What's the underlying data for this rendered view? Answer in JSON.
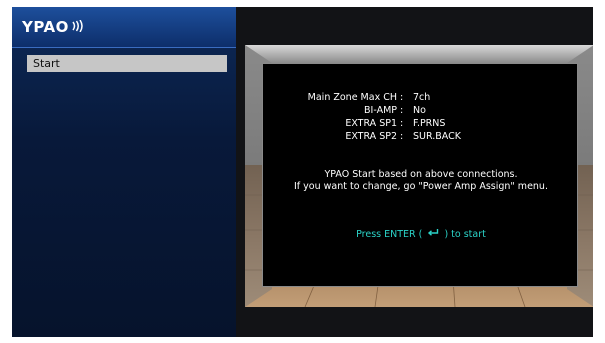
{
  "app": {
    "logo_text": "YPAO"
  },
  "sidebar": {
    "items": [
      {
        "label": "Start"
      }
    ]
  },
  "connections": [
    {
      "label": "Main Zone Max CH",
      "value": "7ch"
    },
    {
      "label": "BI-AMP",
      "value": "No"
    },
    {
      "label": "EXTRA SP1",
      "value": "F.PRNS"
    },
    {
      "label": "EXTRA SP2",
      "value": "SUR.BACK"
    }
  ],
  "separator": ":",
  "message": {
    "line1": "YPAO Start based on above connections.",
    "line2": "If you want to change, go \"Power Amp Assign\" menu."
  },
  "prompt": {
    "before": "Press ENTER (",
    "icon": "enter-return-icon",
    "after": ") to start"
  },
  "colors": {
    "header_blue": "#1d4f9c",
    "prompt_cyan": "#2bd3c8",
    "highlight_gray": "#c6c6c6"
  }
}
